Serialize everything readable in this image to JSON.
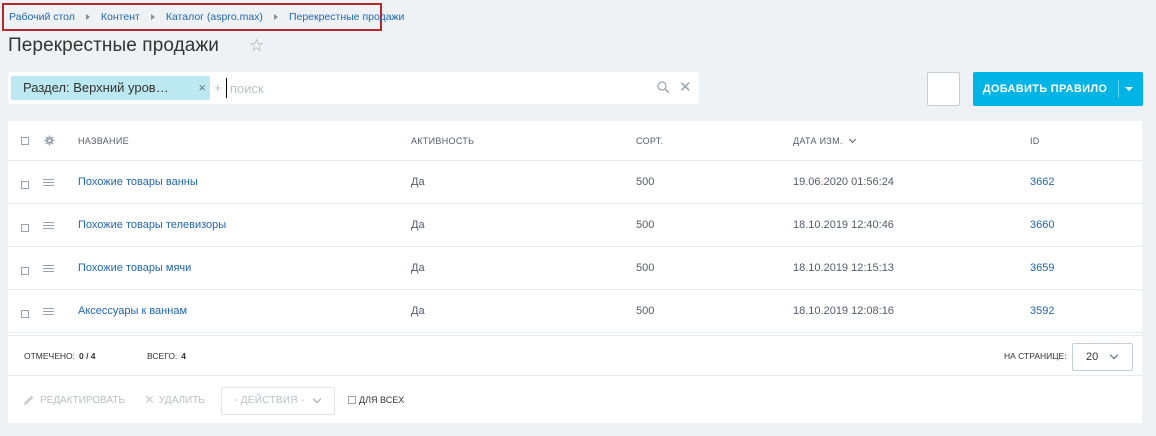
{
  "breadcrumb": [
    "Рабочий стол",
    "Контент",
    "Каталог (aspro.max)",
    "Перекрестные продажи"
  ],
  "page": {
    "title": "Перекрестные продажи"
  },
  "filter": {
    "chip_label": "Раздел: Верхний уров…",
    "plus": "+",
    "search_placeholder": "поиск"
  },
  "toolbar": {
    "add_button_label": "ДОБАВИТЬ ПРАВИЛО"
  },
  "table": {
    "columns": [
      "НАЗВАНИЕ",
      "АКТИВНОСТЬ",
      "СОРТ.",
      "ДАТА ИЗМ.",
      "ID"
    ],
    "rows": [
      {
        "name": "Похожие товары ванны",
        "active": "Да",
        "sort": "500",
        "date": "19.06.2020 01:56:24",
        "id": "3662"
      },
      {
        "name": "Похожие товары телевизоры",
        "active": "Да",
        "sort": "500",
        "date": "18.10.2019 12:40:46",
        "id": "3660"
      },
      {
        "name": "Похожие товары мячи",
        "active": "Да",
        "sort": "500",
        "date": "18.10.2019 12:15:13",
        "id": "3659"
      },
      {
        "name": "Аксессуары к ваннам",
        "active": "Да",
        "sort": "500",
        "date": "18.10.2019 12:08:16",
        "id": "3592"
      }
    ]
  },
  "footer": {
    "selected_label": "ОТМЕЧЕНО:",
    "selected_value": "0 / 4",
    "total_label": "ВСЕГО:",
    "total_value": "4",
    "per_page_label": "НА СТРАНИЦЕ:",
    "per_page_value": "20"
  },
  "actions": {
    "edit": "РЕДАКТИРОВАТЬ",
    "delete": "УДАЛИТЬ",
    "select": "- ДЕЙСТВИЯ -",
    "for_all": "ДЛЯ ВСЕХ"
  },
  "colors": {
    "accent": "#00b4e5",
    "link": "#2067b0",
    "chip": "#bce8f1",
    "highlight_border": "#b5262d"
  }
}
